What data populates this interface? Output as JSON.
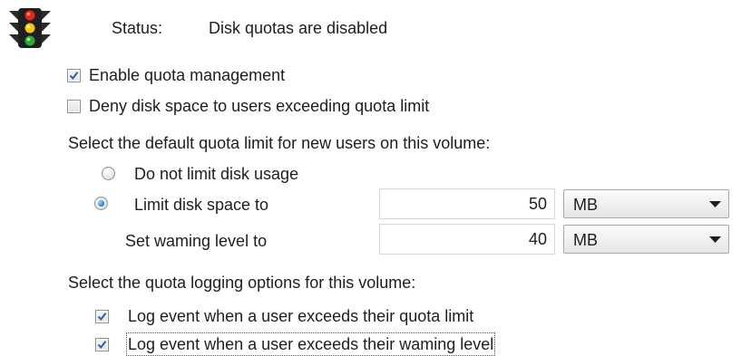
{
  "status": {
    "label": "Status:",
    "text": "Disk quotas are disabled"
  },
  "enable_quota": {
    "label": "Enable quota management",
    "checked": true
  },
  "deny_space": {
    "label": "Deny disk space to users exceeding quota limit",
    "checked": false
  },
  "default_limit": {
    "heading": "Select the default quota limit for new users on this volume:",
    "no_limit_label": "Do not limit disk usage",
    "limit_label": "Limit disk space to",
    "limit_value": "50",
    "limit_unit": "MB",
    "warning_label": "Set waming level to",
    "warning_value": "40",
    "warning_unit": "MB",
    "selected": "limit"
  },
  "logging": {
    "heading": "Select the quota logging options for this volume:",
    "log_limit_label": "Log event when a user exceeds their quota limit",
    "log_limit_checked": true,
    "log_warning_label": "Log event when a user exceeds their waming level",
    "log_warning_checked": true
  },
  "icons": {
    "traffic_light": "traffic-light-icon",
    "dropdown_arrow": "chevron-down-icon",
    "check": "checkmark-icon"
  }
}
